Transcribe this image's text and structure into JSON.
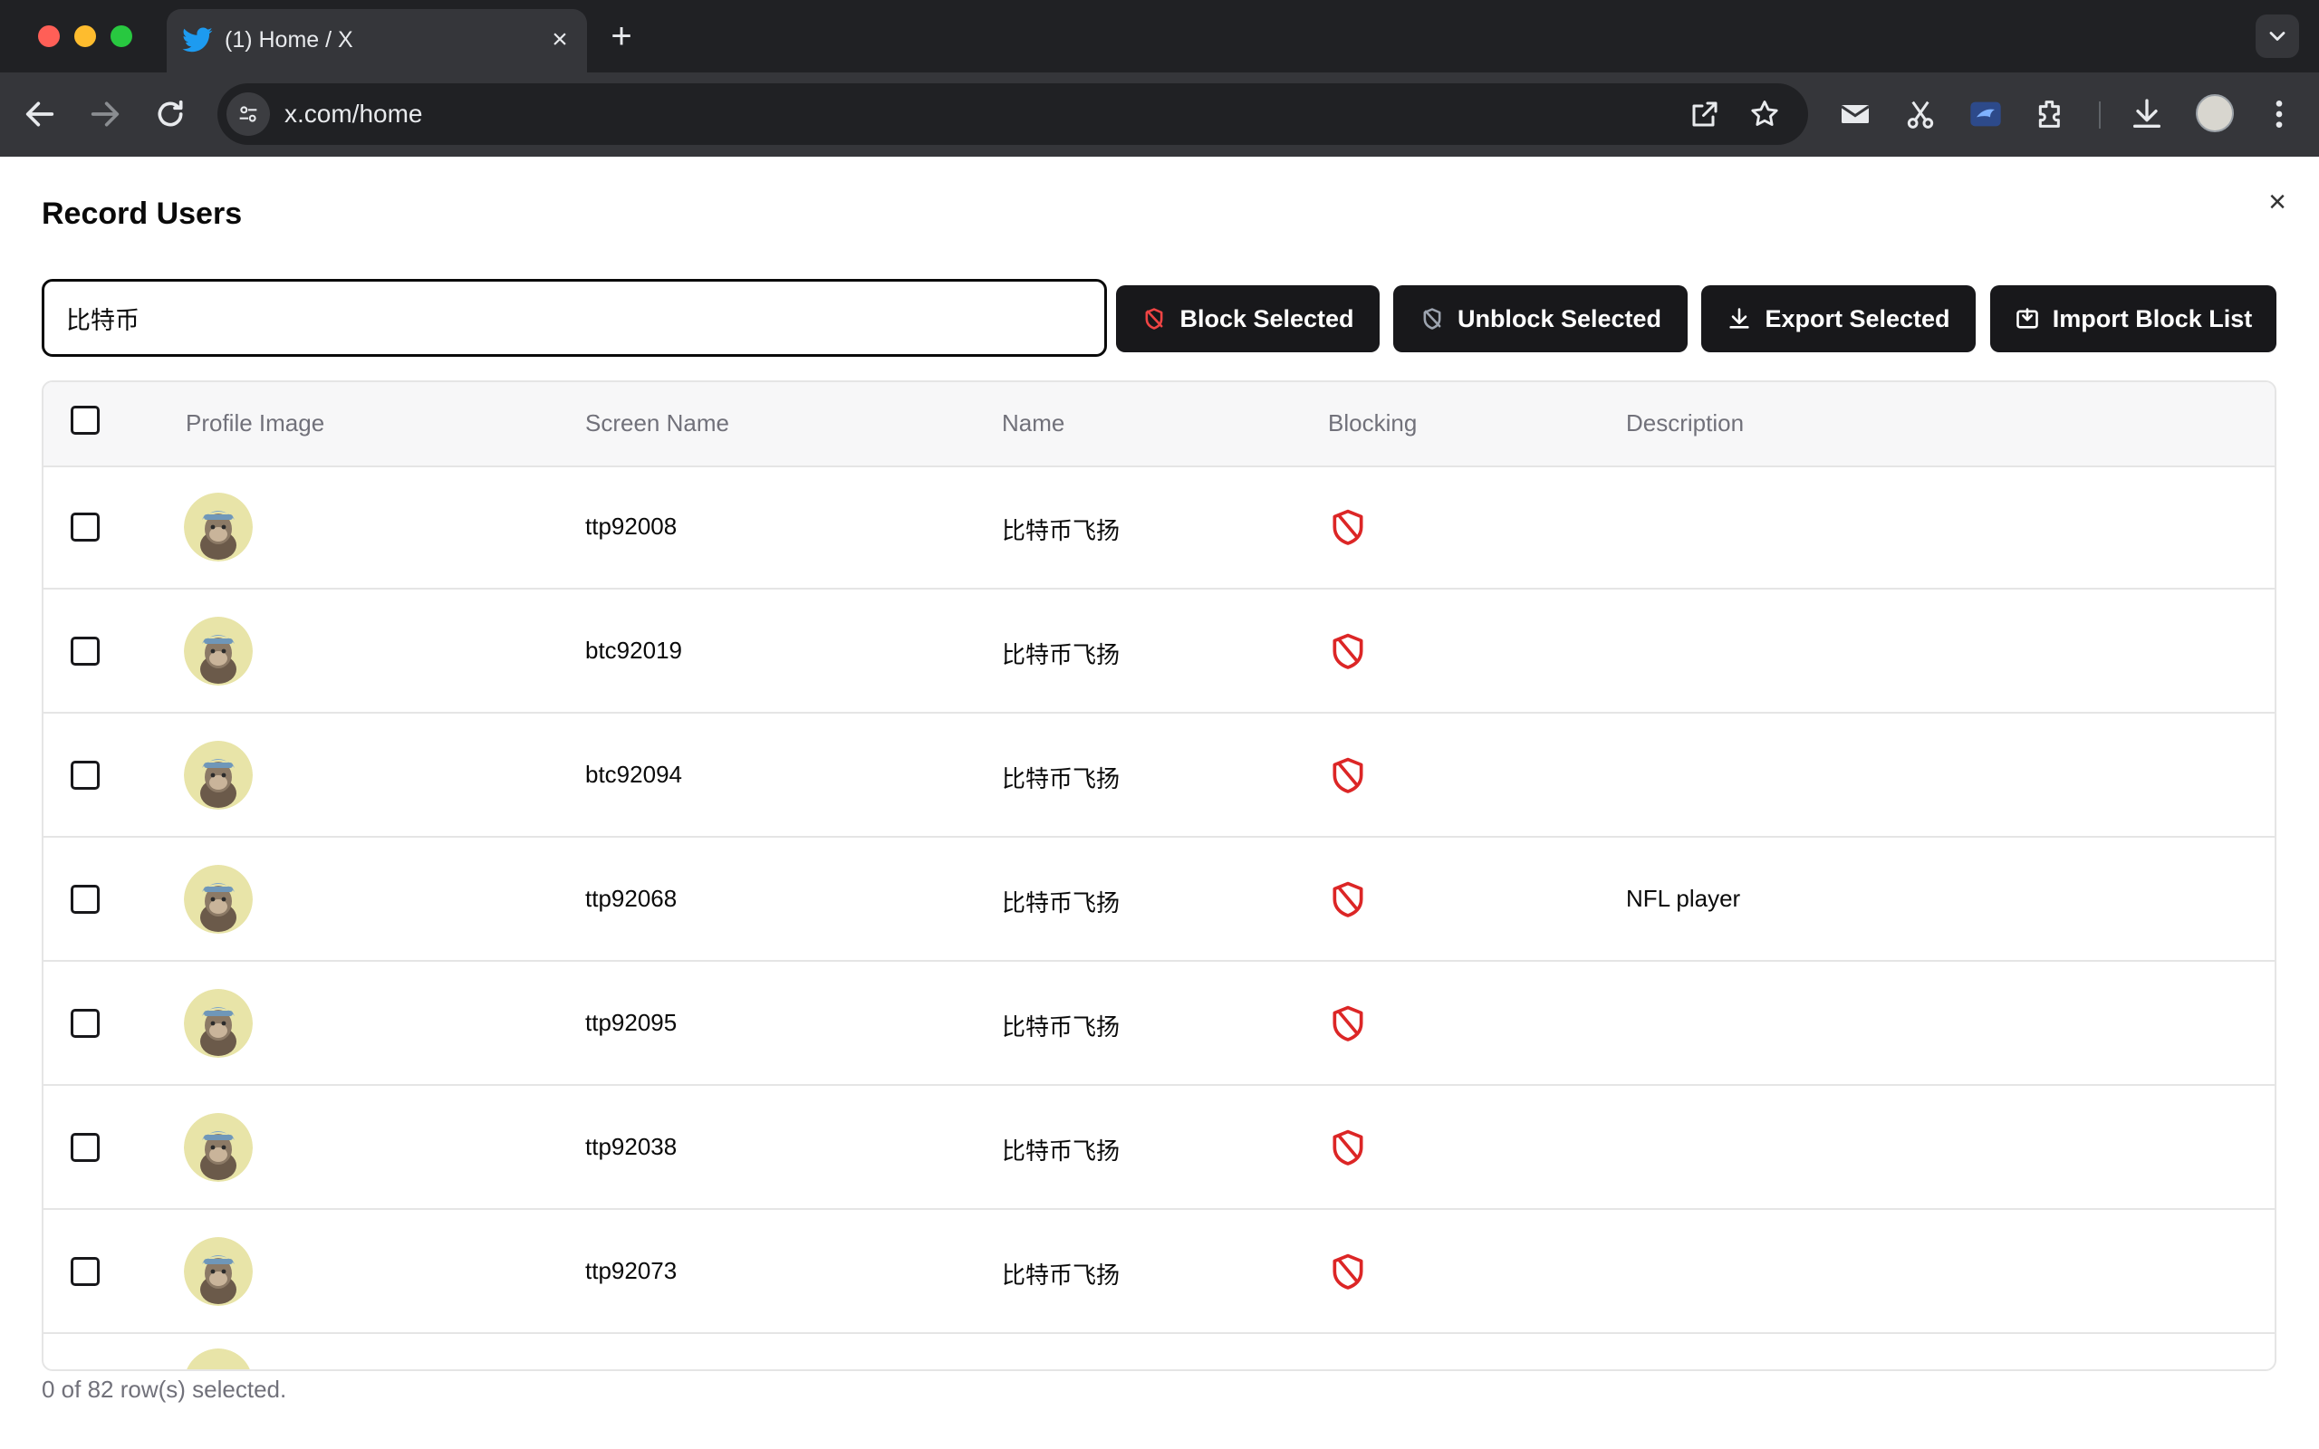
{
  "browser": {
    "tab_title": "(1) Home / X",
    "tab_close": "×",
    "new_tab": "+",
    "url": "x.com/home",
    "accent_close": "#ff5f57",
    "accent_minimize": "#febc2e",
    "accent_maximize": "#28c840"
  },
  "dialog": {
    "title": "Record Users",
    "close": "×"
  },
  "search": {
    "value": "比特币"
  },
  "buttons": {
    "block": "Block Selected",
    "unblock": "Unblock Selected",
    "export": "Export Selected",
    "import": "Import Block List"
  },
  "table": {
    "headers": {
      "profile_image": "Profile Image",
      "screen_name": "Screen Name",
      "name": "Name",
      "blocking": "Blocking",
      "description": "Description"
    },
    "rows": [
      {
        "screen_name": "ttp92008",
        "name": "比特币飞扬",
        "blocking": "shield-blocked-icon",
        "description": ""
      },
      {
        "screen_name": "btc92019",
        "name": "比特币飞扬",
        "blocking": "shield-blocked-icon",
        "description": ""
      },
      {
        "screen_name": "btc92094",
        "name": "比特币飞扬",
        "blocking": "shield-blocked-icon",
        "description": ""
      },
      {
        "screen_name": "ttp92068",
        "name": "比特币飞扬",
        "blocking": "shield-blocked-icon",
        "description": "NFL player"
      },
      {
        "screen_name": "ttp92095",
        "name": "比特币飞扬",
        "blocking": "shield-blocked-icon",
        "description": ""
      },
      {
        "screen_name": "ttp92038",
        "name": "比特币飞扬",
        "blocking": "shield-blocked-icon",
        "description": ""
      },
      {
        "screen_name": "ttp92073",
        "name": "比特币飞扬",
        "blocking": "shield-blocked-icon",
        "description": ""
      }
    ]
  },
  "footer": {
    "selection_text": "0 of 82 row(s) selected."
  },
  "colors": {
    "button_bg": "#18181b",
    "block_icon": "#dc2626",
    "muted_text": "#71717a"
  }
}
